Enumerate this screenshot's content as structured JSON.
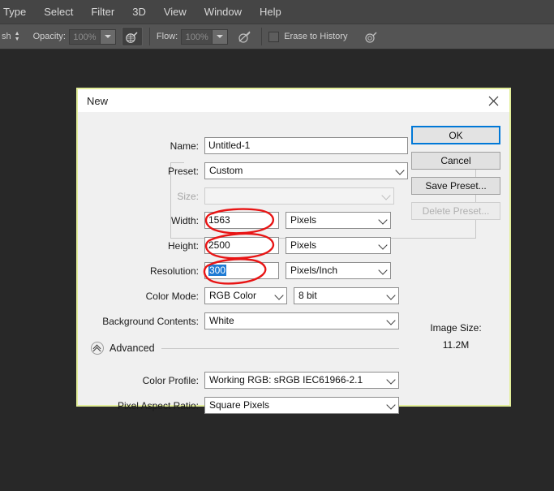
{
  "menubar": {
    "items": [
      {
        "label": "Type"
      },
      {
        "label": "Select"
      },
      {
        "label": "Filter"
      },
      {
        "label": "3D"
      },
      {
        "label": "View"
      },
      {
        "label": "Window"
      },
      {
        "label": "Help"
      }
    ]
  },
  "options_bar": {
    "brush_label": "sh",
    "opacity_label": "Opacity:",
    "opacity_value": "100%",
    "flow_label": "Flow:",
    "flow_value": "100%",
    "erase_to_history_label": "Erase to History",
    "erase_to_history_checked": false,
    "airbrush_icon": "airbrush-icon",
    "smoothing_icon": "airbrush-off-icon",
    "pressure_icon": "tablet-pressure-icon"
  },
  "dialog": {
    "title": "New",
    "close_icon": "close-icon",
    "border_color": "#e3ef9a",
    "fields": {
      "name": {
        "label": "Name:",
        "value": "Untitled-1"
      },
      "preset": {
        "label": "Preset:",
        "value": "Custom"
      },
      "size": {
        "label": "Size:",
        "value": "",
        "disabled": true
      },
      "width": {
        "label": "Width:",
        "value": "1563",
        "unit": "Pixels"
      },
      "height": {
        "label": "Height:",
        "value": "2500",
        "unit": "Pixels"
      },
      "resolution": {
        "label": "Resolution:",
        "value": "300",
        "unit": "Pixels/Inch",
        "selected": true
      },
      "color_mode": {
        "label": "Color Mode:",
        "value": "RGB Color",
        "depth": "8 bit"
      },
      "background_contents": {
        "label": "Background Contents:",
        "value": "White"
      },
      "color_profile": {
        "label": "Color Profile:",
        "value": "Working RGB:  sRGB IEC61966-2.1"
      },
      "pixel_aspect_ratio": {
        "label": "Pixel Aspect Ratio:",
        "value": "Square Pixels"
      }
    },
    "advanced": {
      "label": "Advanced",
      "expanded": true,
      "toggle_icon": "chevron-double-up-icon"
    },
    "buttons": {
      "ok": "OK",
      "cancel": "Cancel",
      "save_preset": "Save Preset...",
      "delete_preset": "Delete Preset..."
    },
    "image_size": {
      "label": "Image Size:",
      "value": "11.2M"
    }
  },
  "annotations": {
    "color": "#e81414",
    "marks": [
      "circle-width-value",
      "circle-height-value",
      "circle-resolution-value"
    ]
  }
}
